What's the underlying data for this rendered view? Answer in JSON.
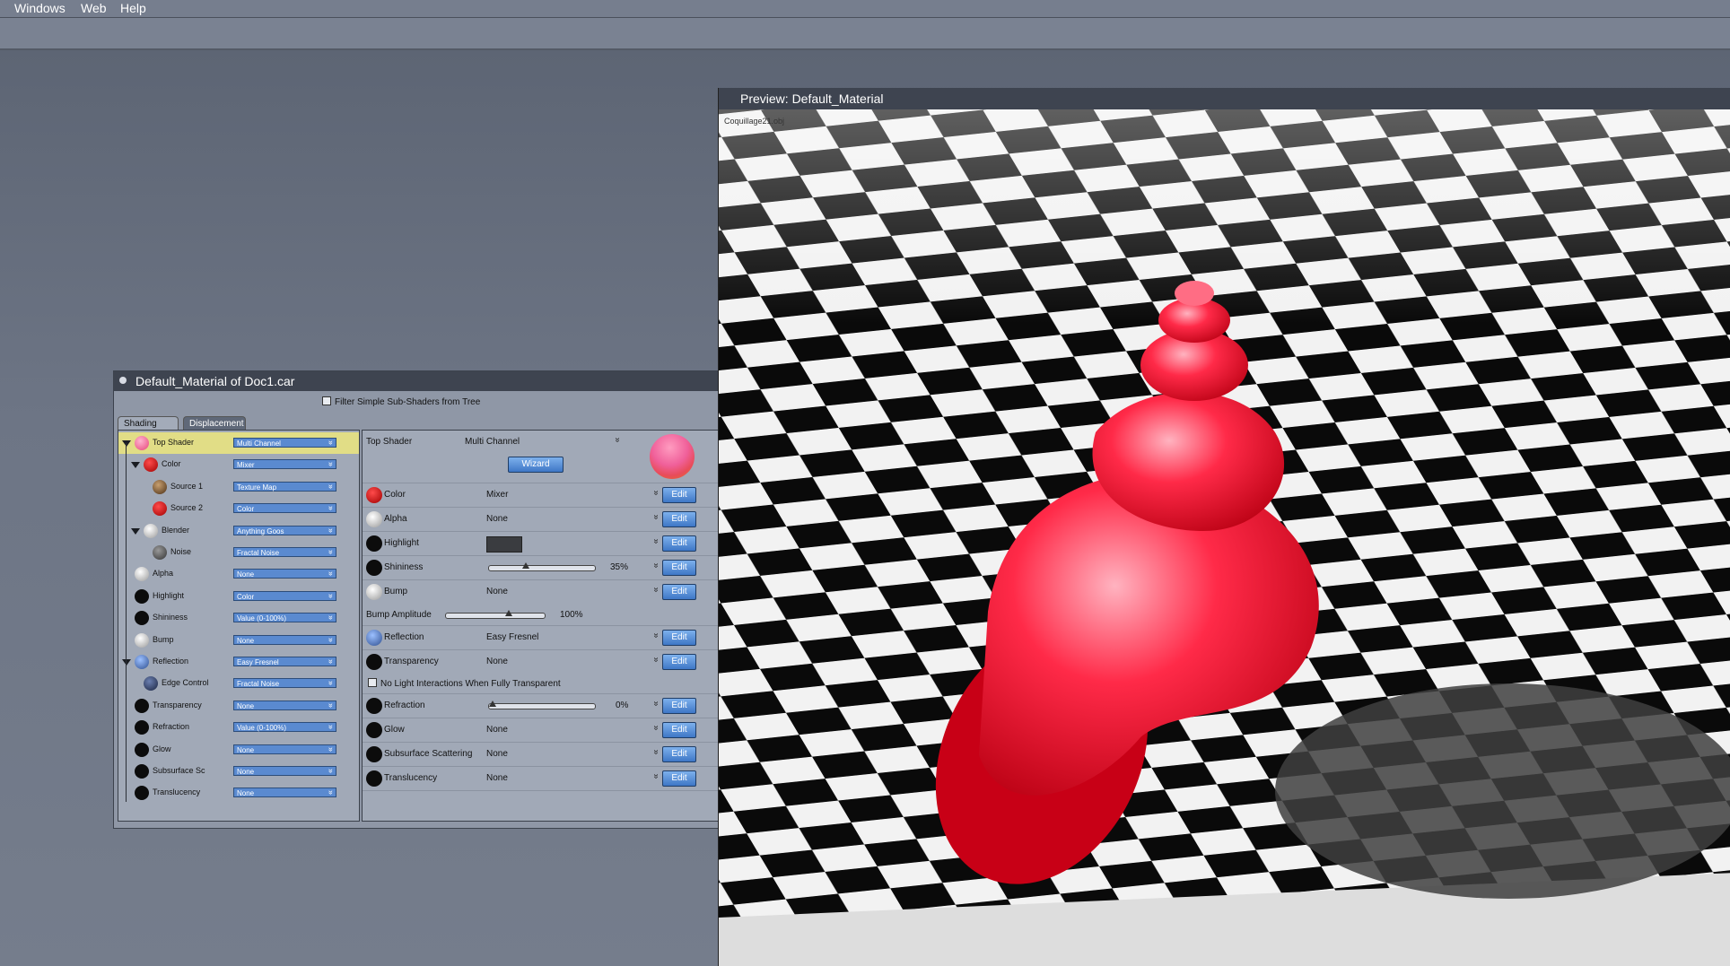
{
  "menubar": {
    "items": [
      "Windows",
      "Web",
      "Help"
    ]
  },
  "material_editor": {
    "title": "Default_Material of Doc1.car",
    "filter_label": "Filter Simple Sub-Shaders from Tree",
    "tabs": [
      "Shading",
      "Displacement"
    ],
    "tree": [
      {
        "label": "Top Shader",
        "value": "Multi Channel",
        "icon": "pink"
      },
      {
        "label": "Color",
        "value": "Mixer",
        "icon": "red"
      },
      {
        "label": "Source 1",
        "value": "Texture Map",
        "icon": "texture"
      },
      {
        "label": "Source 2",
        "value": "Color",
        "icon": "red"
      },
      {
        "label": "Blender",
        "value": "Anything Goos",
        "icon": "white"
      },
      {
        "label": "Noise",
        "value": "Fractal Noise",
        "icon": "grey"
      },
      {
        "label": "Alpha",
        "value": "None",
        "icon": "white"
      },
      {
        "label": "Highlight",
        "value": "Color",
        "icon": "black"
      },
      {
        "label": "Shininess",
        "value": "Value (0-100%)",
        "icon": "black"
      },
      {
        "label": "Bump",
        "value": "None",
        "icon": "white"
      },
      {
        "label": "Reflection",
        "value": "Easy Fresnel",
        "icon": "blue"
      },
      {
        "label": "Edge Control",
        "value": "Fractal Noise",
        "icon": "darkblue"
      },
      {
        "label": "Transparency",
        "value": "None",
        "icon": "black"
      },
      {
        "label": "Refraction",
        "value": "Value (0-100%)",
        "icon": "black"
      },
      {
        "label": "Glow",
        "value": "None",
        "icon": "black"
      },
      {
        "label": "Subsurface Sc",
        "value": "None",
        "icon": "black"
      },
      {
        "label": "Translucency",
        "value": "None",
        "icon": "black"
      }
    ],
    "props": {
      "top_shader_label": "Top Shader",
      "top_shader_value": "Multi Channel",
      "wizard_label": "Wizard",
      "edit_label": "Edit",
      "color": {
        "label": "Color",
        "value": "Mixer"
      },
      "alpha": {
        "label": "Alpha",
        "value": "None"
      },
      "highlight": {
        "label": "Highlight"
      },
      "shininess": {
        "label": "Shininess",
        "pct": "35%",
        "level": 0.35
      },
      "bump": {
        "label": "Bump",
        "value": "None"
      },
      "bump_amplitude": {
        "label": "Bump Amplitude",
        "pct": "100%",
        "level": 0.6
      },
      "reflection": {
        "label": "Reflection",
        "value": "Easy Fresnel"
      },
      "transparency": {
        "label": "Transparency",
        "value": "None"
      },
      "no_light_label": "No Light Interactions When Fully Transparent",
      "refraction": {
        "label": "Refraction",
        "pct": "0%",
        "level": 0.0
      },
      "glow": {
        "label": "Glow",
        "value": "None"
      },
      "subsurface": {
        "label": "Subsurface Scattering",
        "value": "None"
      },
      "translucency": {
        "label": "Translucency",
        "value": "None"
      }
    }
  },
  "preview": {
    "title": "Preview: Default_Material",
    "object_name": "Coquillage21.obj"
  },
  "colors": {
    "accent_blue": "#3e77c6",
    "selection_yellow": "#e1dd86",
    "shell_red": "#e8102a"
  }
}
